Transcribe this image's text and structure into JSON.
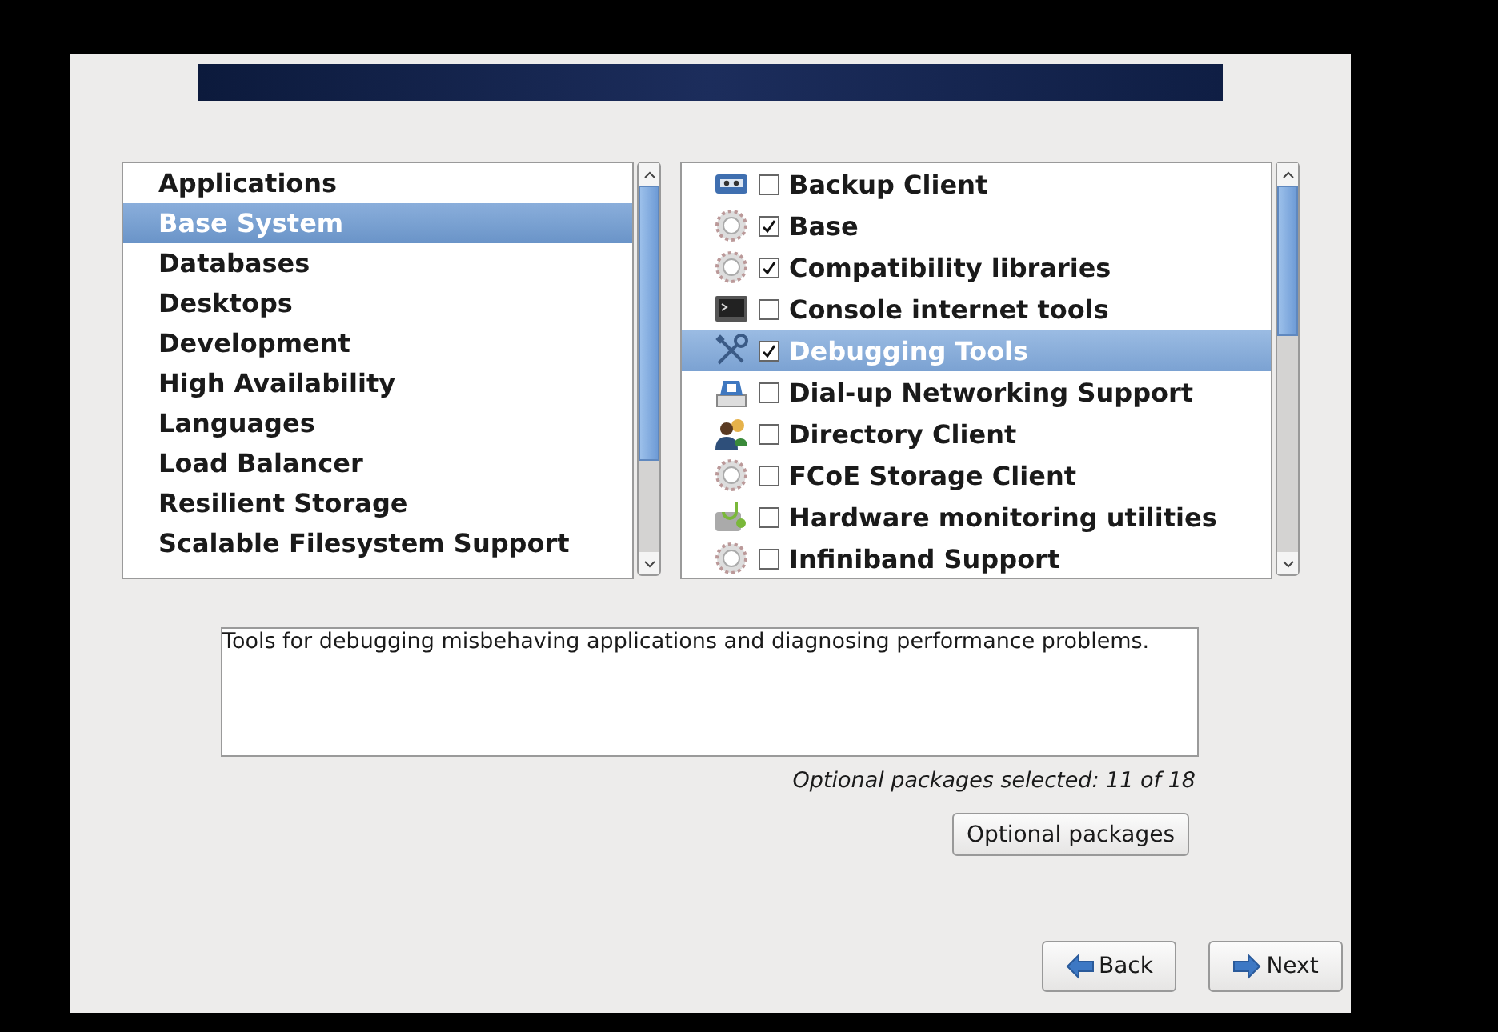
{
  "groups": [
    {
      "label": "Applications",
      "selected": false
    },
    {
      "label": "Base System",
      "selected": true
    },
    {
      "label": "Databases",
      "selected": false
    },
    {
      "label": "Desktops",
      "selected": false
    },
    {
      "label": "Development",
      "selected": false
    },
    {
      "label": "High Availability",
      "selected": false
    },
    {
      "label": "Languages",
      "selected": false
    },
    {
      "label": "Load Balancer",
      "selected": false
    },
    {
      "label": "Resilient Storage",
      "selected": false
    },
    {
      "label": "Scalable Filesystem Support",
      "selected": false
    }
  ],
  "packages": [
    {
      "label": "Backup Client",
      "kind": "tape",
      "checked": false,
      "selected": false
    },
    {
      "label": "Base",
      "kind": "gear",
      "checked": true,
      "selected": false
    },
    {
      "label": "Compatibility libraries",
      "kind": "gear",
      "checked": true,
      "selected": false
    },
    {
      "label": "Console internet tools",
      "kind": "terminal",
      "checked": false,
      "selected": false
    },
    {
      "label": "Debugging Tools",
      "kind": "tools",
      "checked": true,
      "selected": true
    },
    {
      "label": "Dial-up Networking Support",
      "kind": "phone",
      "checked": false,
      "selected": false
    },
    {
      "label": "Directory Client",
      "kind": "people",
      "checked": false,
      "selected": false
    },
    {
      "label": "FCoE Storage Client",
      "kind": "gear",
      "checked": false,
      "selected": false
    },
    {
      "label": "Hardware monitoring utilities",
      "kind": "monitor",
      "checked": false,
      "selected": false
    },
    {
      "label": "Infiniband Support",
      "kind": "gear",
      "checked": false,
      "selected": false
    }
  ],
  "description": "Tools for debugging misbehaving applications and diagnosing performance problems.",
  "optional_status": "Optional packages selected: 11 of 18",
  "optional_button": "Optional packages",
  "buttons": [
    {
      "label": "Back",
      "kind": "back"
    },
    {
      "label": "Next",
      "kind": "next"
    }
  ]
}
